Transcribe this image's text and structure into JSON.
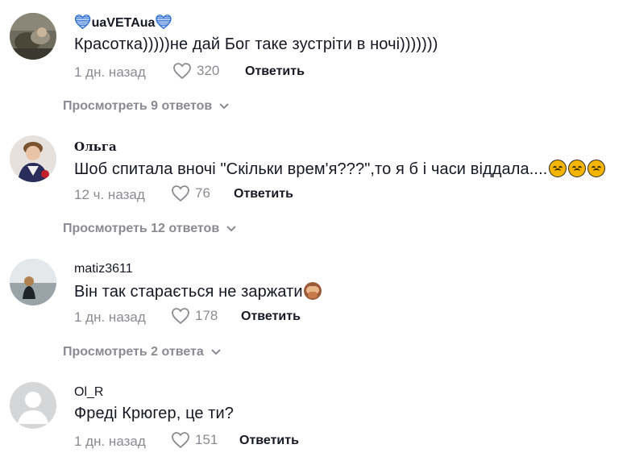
{
  "comments": [
    {
      "username_prefix_icon": "blue-heart",
      "username": "uaVETAua",
      "username_suffix_icon": "blue-heart",
      "text": "Красотка)))))не дай Бог таке зустріти в ночі)))))))",
      "time": "1 дн. назад",
      "likes": "320",
      "reply_label": "Ответить",
      "view_replies": "Просмотреть 9 ответов"
    },
    {
      "username": "Ольга",
      "text": "Шоб спитала вночі \"Скільки врем'я???\",то я б і часи віддала....",
      "text_emojis": [
        "frowning-face",
        "frowning-face",
        "frowning-face"
      ],
      "time": "12 ч. назад",
      "likes": "76",
      "reply_label": "Ответить",
      "view_replies": "Просмотреть 12 ответов"
    },
    {
      "username": "matiz3611",
      "text": "Він так старається не заржати",
      "text_emojis": [
        "see-no-evil-monkey"
      ],
      "time": "1 дн. назад",
      "likes": "178",
      "reply_label": "Ответить",
      "view_replies": "Просмотреть 2 ответа"
    },
    {
      "username": "Ol_R",
      "text": "Фреді Крюгер, це ти?",
      "time": "1 дн. назад",
      "likes": "151",
      "reply_label": "Ответить"
    }
  ],
  "colors": {
    "text": "#161823",
    "muted": "#8a8b91",
    "heart_blue": "#2f6fd6"
  }
}
